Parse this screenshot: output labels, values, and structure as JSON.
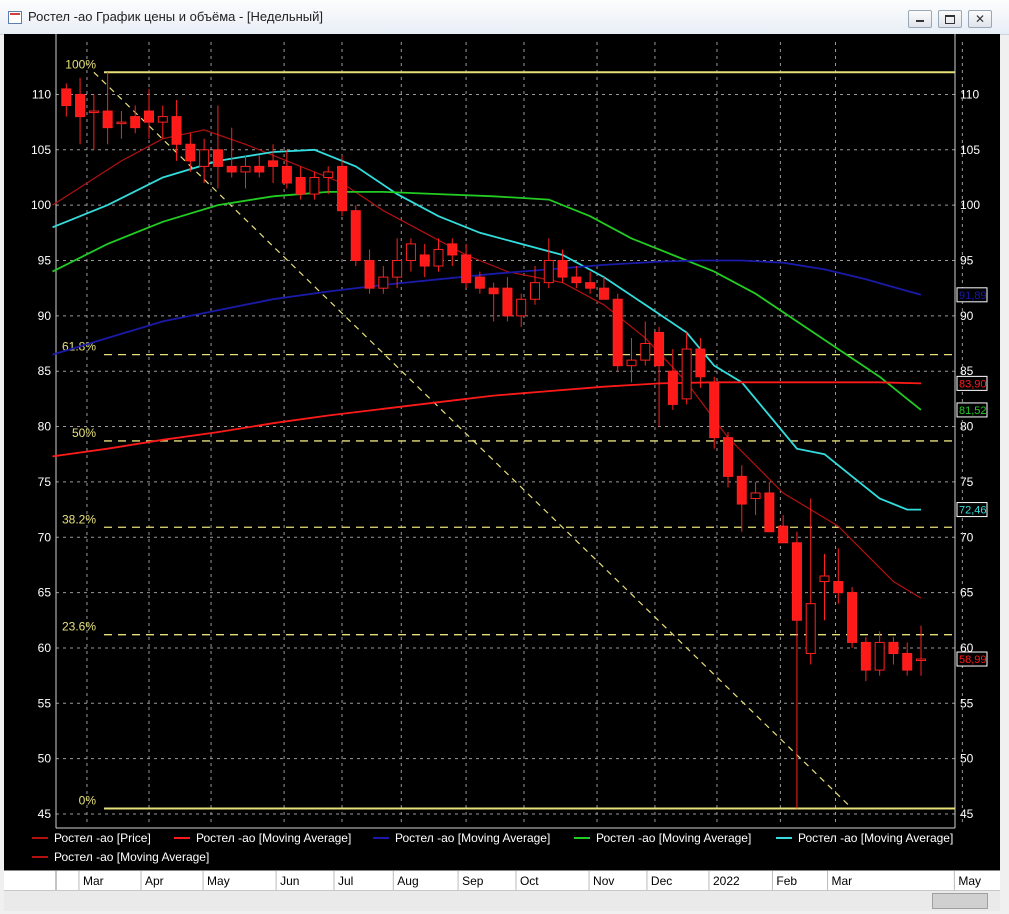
{
  "window": {
    "title": "Ростел -ао График цены и объёма - [Недельный]",
    "close_glyph": "✕"
  },
  "colors": {
    "background": "#000000",
    "up_candle": "#000000",
    "down_candle": "#ff1a1a",
    "candle_outline": "#ff2020",
    "fib": "#e6e07a",
    "ma_dark_red": "#b31010",
    "ma_red": "#ff1a1a",
    "ma_blue": "#1a1aa8",
    "ma_green": "#22cc22",
    "ma_cyan": "#33dddd"
  },
  "chart_data": {
    "type": "candlestick",
    "y_ticks": [
      110,
      105,
      100,
      95,
      90,
      85,
      80,
      75,
      70,
      65,
      60,
      55,
      50,
      45
    ],
    "x_ticks": [
      {
        "label": "Mar",
        "week": 2.5
      },
      {
        "label": "Apr",
        "week": 7
      },
      {
        "label": "May",
        "week": 11.5
      },
      {
        "label": "Jun",
        "week": 16.8
      },
      {
        "label": "Jul",
        "week": 21
      },
      {
        "label": "Aug",
        "week": 25.3
      },
      {
        "label": "Sep",
        "week": 30
      },
      {
        "label": "Oct",
        "week": 34.2
      },
      {
        "label": "Nov",
        "week": 39.5
      },
      {
        "label": "Dec",
        "week": 43.7
      },
      {
        "label": "2022",
        "week": 48.2
      },
      {
        "label": "Feb",
        "week": 52.8
      },
      {
        "label": "Mar",
        "week": 56.8
      },
      {
        "label": "May",
        "week": 66
      }
    ],
    "candles": [
      {
        "w": 1,
        "o": 110.5,
        "h": 111.0,
        "l": 108.0,
        "c": 109.0
      },
      {
        "w": 2,
        "o": 110.0,
        "h": 111.5,
        "l": 105.5,
        "c": 108.0
      },
      {
        "w": 3,
        "o": 108.5,
        "h": 110.0,
        "l": 105.0,
        "c": 108.5
      },
      {
        "w": 4,
        "o": 108.5,
        "h": 112.0,
        "l": 105.5,
        "c": 107.0
      },
      {
        "w": 5,
        "o": 107.5,
        "h": 108.5,
        "l": 106.0,
        "c": 107.5
      },
      {
        "w": 6,
        "o": 108.0,
        "h": 109.0,
        "l": 106.5,
        "c": 107.0
      },
      {
        "w": 7,
        "o": 108.5,
        "h": 110.5,
        "l": 106.0,
        "c": 107.5
      },
      {
        "w": 8,
        "o": 107.5,
        "h": 109.0,
        "l": 106.0,
        "c": 108.0
      },
      {
        "w": 9,
        "o": 108.0,
        "h": 109.5,
        "l": 104.0,
        "c": 105.5
      },
      {
        "w": 10,
        "o": 105.5,
        "h": 106.5,
        "l": 103.0,
        "c": 104.0
      },
      {
        "w": 11,
        "o": 103.5,
        "h": 106.0,
        "l": 102.0,
        "c": 105.0
      },
      {
        "w": 12,
        "o": 105.0,
        "h": 109.0,
        "l": 101.5,
        "c": 103.5
      },
      {
        "w": 13,
        "o": 103.5,
        "h": 107.0,
        "l": 102.5,
        "c": 103.0
      },
      {
        "w": 14,
        "o": 103.0,
        "h": 104.5,
        "l": 101.5,
        "c": 103.5
      },
      {
        "w": 15,
        "o": 103.5,
        "h": 104.5,
        "l": 102.5,
        "c": 103.0
      },
      {
        "w": 16,
        "o": 104.0,
        "h": 105.5,
        "l": 102.0,
        "c": 103.5
      },
      {
        "w": 17,
        "o": 103.5,
        "h": 105.0,
        "l": 101.5,
        "c": 102.0
      },
      {
        "w": 18,
        "o": 102.5,
        "h": 103.5,
        "l": 100.5,
        "c": 101.0
      },
      {
        "w": 19,
        "o": 101.0,
        "h": 103.0,
        "l": 100.5,
        "c": 102.5
      },
      {
        "w": 20,
        "o": 102.5,
        "h": 103.5,
        "l": 101.0,
        "c": 103.0
      },
      {
        "w": 21,
        "o": 103.5,
        "h": 104.5,
        "l": 99.0,
        "c": 99.5
      },
      {
        "w": 22,
        "o": 99.5,
        "h": 100.0,
        "l": 94.5,
        "c": 95.0
      },
      {
        "w": 23,
        "o": 95.0,
        "h": 96.0,
        "l": 92.0,
        "c": 92.5
      },
      {
        "w": 24,
        "o": 92.5,
        "h": 94.5,
        "l": 92.0,
        "c": 93.5
      },
      {
        "w": 25,
        "o": 93.5,
        "h": 97.0,
        "l": 92.5,
        "c": 95.0
      },
      {
        "w": 26,
        "o": 95.0,
        "h": 97.0,
        "l": 94.0,
        "c": 96.5
      },
      {
        "w": 27,
        "o": 95.5,
        "h": 96.5,
        "l": 93.5,
        "c": 94.5
      },
      {
        "w": 28,
        "o": 94.5,
        "h": 97.0,
        "l": 94.0,
        "c": 96.0
      },
      {
        "w": 29,
        "o": 96.5,
        "h": 97.0,
        "l": 94.5,
        "c": 95.5
      },
      {
        "w": 30,
        "o": 95.5,
        "h": 96.5,
        "l": 92.5,
        "c": 93.0
      },
      {
        "w": 31,
        "o": 93.5,
        "h": 94.0,
        "l": 92.0,
        "c": 92.5
      },
      {
        "w": 32,
        "o": 92.5,
        "h": 93.0,
        "l": 89.5,
        "c": 92.0
      },
      {
        "w": 33,
        "o": 92.5,
        "h": 93.5,
        "l": 89.5,
        "c": 90.0
      },
      {
        "w": 34,
        "o": 90.0,
        "h": 92.0,
        "l": 89.0,
        "c": 91.5
      },
      {
        "w": 35,
        "o": 91.5,
        "h": 94.5,
        "l": 91.0,
        "c": 93.0
      },
      {
        "w": 36,
        "o": 93.0,
        "h": 97.0,
        "l": 92.5,
        "c": 95.0
      },
      {
        "w": 37,
        "o": 95.0,
        "h": 96.0,
        "l": 93.0,
        "c": 93.5
      },
      {
        "w": 38,
        "o": 93.5,
        "h": 94.5,
        "l": 92.5,
        "c": 93.0
      },
      {
        "w": 39,
        "o": 93.0,
        "h": 94.0,
        "l": 92.0,
        "c": 92.5
      },
      {
        "w": 40,
        "o": 92.5,
        "h": 93.5,
        "l": 91.5,
        "c": 91.5
      },
      {
        "w": 41,
        "o": 91.5,
        "h": 92.0,
        "l": 85.0,
        "c": 85.5
      },
      {
        "w": 42,
        "o": 85.5,
        "h": 88.0,
        "l": 84.0,
        "c": 86.0
      },
      {
        "w": 43,
        "o": 86.0,
        "h": 89.5,
        "l": 85.5,
        "c": 87.5
      },
      {
        "w": 44,
        "o": 88.5,
        "h": 89.0,
        "l": 80.0,
        "c": 85.5
      },
      {
        "w": 45,
        "o": 85.0,
        "h": 87.0,
        "l": 81.5,
        "c": 82.0
      },
      {
        "w": 46,
        "o": 82.5,
        "h": 88.5,
        "l": 82.0,
        "c": 87.0
      },
      {
        "w": 47,
        "o": 87.0,
        "h": 88.0,
        "l": 83.5,
        "c": 84.5
      },
      {
        "w": 48,
        "o": 84.0,
        "h": 84.5,
        "l": 78.0,
        "c": 79.0
      },
      {
        "w": 49,
        "o": 79.0,
        "h": 79.5,
        "l": 74.5,
        "c": 75.5
      },
      {
        "w": 50,
        "o": 75.5,
        "h": 76.5,
        "l": 70.5,
        "c": 73.0
      },
      {
        "w": 51,
        "o": 73.5,
        "h": 75.0,
        "l": 72.0,
        "c": 74.0
      },
      {
        "w": 52,
        "o": 74.0,
        "h": 75.0,
        "l": 70.5,
        "c": 70.5
      },
      {
        "w": 53,
        "o": 71.0,
        "h": 72.0,
        "l": 69.5,
        "c": 69.5
      },
      {
        "w": 54,
        "o": 69.5,
        "h": 70.5,
        "l": 45.5,
        "c": 62.5
      },
      {
        "w": 55,
        "o": 59.5,
        "h": 73.5,
        "l": 58.5,
        "c": 64.0
      },
      {
        "w": 56,
        "o": 66.0,
        "h": 68.5,
        "l": 62.5,
        "c": 66.5
      },
      {
        "w": 57,
        "o": 66.0,
        "h": 69.0,
        "l": 64.0,
        "c": 65.0
      },
      {
        "w": 58,
        "o": 65.0,
        "h": 65.5,
        "l": 60.0,
        "c": 60.5
      },
      {
        "w": 59,
        "o": 60.5,
        "h": 61.0,
        "l": 57.0,
        "c": 58.0
      },
      {
        "w": 60,
        "o": 58.0,
        "h": 61.5,
        "l": 57.5,
        "c": 60.5
      },
      {
        "w": 61,
        "o": 60.5,
        "h": 61.0,
        "l": 58.5,
        "c": 59.5
      },
      {
        "w": 62,
        "o": 59.5,
        "h": 60.5,
        "l": 57.5,
        "c": 58.0
      },
      {
        "w": 63,
        "o": 59.0,
        "h": 62.0,
        "l": 57.5,
        "c": 59.0
      }
    ],
    "moving_averages": [
      {
        "color_key": "ma_dark_red",
        "points": [
          [
            0,
            100.0
          ],
          [
            5,
            104.0
          ],
          [
            8,
            106.0
          ],
          [
            11,
            106.8
          ],
          [
            14,
            105.5
          ],
          [
            18,
            103.5
          ],
          [
            21,
            102.0
          ],
          [
            24,
            99.5
          ],
          [
            27,
            97.5
          ],
          [
            30,
            95.5
          ],
          [
            33,
            94.0
          ],
          [
            35,
            93.5
          ],
          [
            37,
            93.0
          ],
          [
            40,
            91.0
          ],
          [
            43,
            88.0
          ],
          [
            46,
            84.0
          ],
          [
            49,
            79.0
          ],
          [
            51,
            76.5
          ],
          [
            53,
            74.0
          ],
          [
            55,
            72.5
          ],
          [
            57,
            71.0
          ],
          [
            59,
            68.5
          ],
          [
            61,
            66.0
          ],
          [
            63,
            64.5
          ]
        ]
      },
      {
        "color_key": "ma_cyan",
        "points": [
          [
            0,
            98.0
          ],
          [
            4,
            100.0
          ],
          [
            8,
            102.5
          ],
          [
            12,
            104.0
          ],
          [
            16,
            104.8
          ],
          [
            19,
            105.0
          ],
          [
            22,
            103.5
          ],
          [
            25,
            101.0
          ],
          [
            28,
            99.0
          ],
          [
            31,
            97.5
          ],
          [
            34,
            96.5
          ],
          [
            37,
            95.5
          ],
          [
            40,
            93.5
          ],
          [
            43,
            91.0
          ],
          [
            46,
            88.5
          ],
          [
            48,
            85.5
          ],
          [
            50,
            84.0
          ],
          [
            52,
            81.0
          ],
          [
            54,
            78.0
          ],
          [
            56,
            77.5
          ],
          [
            58,
            75.5
          ],
          [
            60,
            73.5
          ],
          [
            62,
            72.5
          ],
          [
            63,
            72.5
          ]
        ]
      },
      {
        "color_key": "ma_green",
        "points": [
          [
            0,
            94.0
          ],
          [
            4,
            96.5
          ],
          [
            8,
            98.5
          ],
          [
            12,
            100.0
          ],
          [
            16,
            100.8
          ],
          [
            20,
            101.2
          ],
          [
            24,
            101.2
          ],
          [
            28,
            101.0
          ],
          [
            32,
            100.8
          ],
          [
            36,
            100.5
          ],
          [
            39,
            99.0
          ],
          [
            42,
            97.0
          ],
          [
            45,
            95.5
          ],
          [
            48,
            94.0
          ],
          [
            51,
            92.0
          ],
          [
            54,
            89.5
          ],
          [
            57,
            87.0
          ],
          [
            60,
            84.5
          ],
          [
            62,
            82.5
          ],
          [
            63,
            81.5
          ]
        ]
      },
      {
        "color_key": "ma_blue",
        "points": [
          [
            0,
            86.5
          ],
          [
            4,
            88.0
          ],
          [
            8,
            89.5
          ],
          [
            12,
            90.5
          ],
          [
            16,
            91.5
          ],
          [
            20,
            92.2
          ],
          [
            24,
            92.8
          ],
          [
            28,
            93.3
          ],
          [
            32,
            93.8
          ],
          [
            36,
            94.2
          ],
          [
            40,
            94.6
          ],
          [
            44,
            94.9
          ],
          [
            47,
            95.0
          ],
          [
            50,
            95.0
          ],
          [
            53,
            94.8
          ],
          [
            56,
            94.2
          ],
          [
            59,
            93.3
          ],
          [
            61,
            92.6
          ],
          [
            63,
            91.9
          ]
        ]
      },
      {
        "color_key": "ma_red",
        "points": [
          [
            0,
            77.3
          ],
          [
            4,
            78.0
          ],
          [
            8,
            78.8
          ],
          [
            12,
            79.5
          ],
          [
            16,
            80.3
          ],
          [
            20,
            81.0
          ],
          [
            24,
            81.6
          ],
          [
            28,
            82.2
          ],
          [
            32,
            82.8
          ],
          [
            36,
            83.2
          ],
          [
            40,
            83.6
          ],
          [
            44,
            83.9
          ],
          [
            48,
            84.0
          ],
          [
            52,
            84.0
          ],
          [
            56,
            84.0
          ],
          [
            60,
            84.0
          ],
          [
            63,
            83.9
          ]
        ]
      }
    ],
    "fibonacci": {
      "levels": [
        {
          "label": "100%",
          "value": 112.0
        },
        {
          "label": "61.8%",
          "value": 86.5
        },
        {
          "label": "50%",
          "value": 78.7
        },
        {
          "label": "38.2%",
          "value": 70.9
        },
        {
          "label": "23.6%",
          "value": 61.2
        },
        {
          "label": "0%",
          "value": 45.5
        }
      ],
      "trend_line": [
        [
          3,
          112.0
        ],
        [
          58,
          45.5
        ]
      ]
    },
    "right_labels": [
      {
        "text": "91,89",
        "value": 91.9,
        "color_key": "ma_blue"
      },
      {
        "text": "83,90",
        "value": 83.9,
        "color_key": "ma_red"
      },
      {
        "text": "81,52",
        "value": 81.5,
        "color_key": "ma_green"
      },
      {
        "text": "72,46",
        "value": 72.5,
        "color_key": "ma_cyan"
      },
      {
        "text": "58,99",
        "value": 59.0,
        "color_key": "ma_red"
      }
    ],
    "legend": [
      {
        "text": "Ростел -ао [Price]",
        "color_key": "ma_dark_red"
      },
      {
        "text": "Ростел -ао [Moving Average]",
        "color_key": "ma_red"
      },
      {
        "text": "Ростел -ао [Moving Average]",
        "color_key": "ma_blue"
      },
      {
        "text": "Ростел -ао [Moving Average]",
        "color_key": "ma_green"
      },
      {
        "text": "Ростел -ао [Moving Average]",
        "color_key": "ma_cyan"
      },
      {
        "text": "Ростел -ао [Moving Average]",
        "color_key": "ma_dark_red"
      }
    ]
  }
}
